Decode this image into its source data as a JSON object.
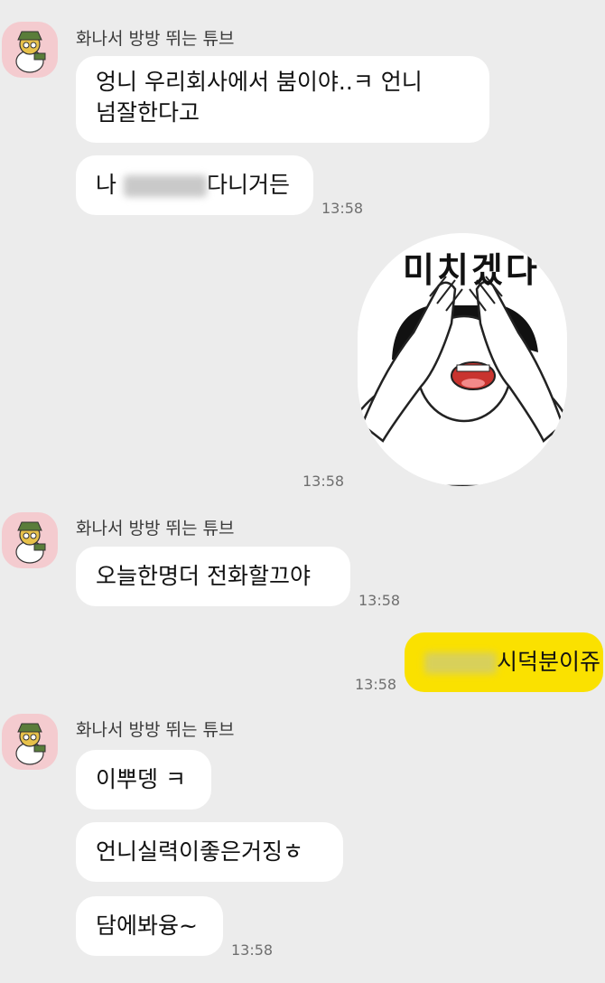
{
  "chat": {
    "sender_name": "화나서 방방 뛰는 튜브",
    "messages": [
      {
        "text": "엉니  우리회사에서 붐이야..ㅋ  언니",
        "text2": "넘잘한다고"
      },
      {
        "prefix": "나 ",
        "suffix": "다니거든",
        "time": "13:58"
      },
      {
        "sticker_text": "미치겠다",
        "time": "13:58"
      },
      {
        "text": "오늘한명더 전화할끄야",
        "time": "13:58"
      },
      {
        "suffix": "시덕분이쥬",
        "time": "13:58"
      },
      {
        "text": "이뿌뎅 ㅋ"
      },
      {
        "text": "언니실력이좋은거징ㅎ"
      },
      {
        "text": "담에봐융~",
        "time": "13:58"
      }
    ]
  },
  "colors": {
    "background": "#ececec",
    "bubble_other": "#ffffff",
    "bubble_me": "#fae100",
    "avatar_bg": "#f4cbcf"
  },
  "icons": {
    "avatar": "tube-character-avatar-icon",
    "sticker": "covering-face-crying-sticker"
  }
}
